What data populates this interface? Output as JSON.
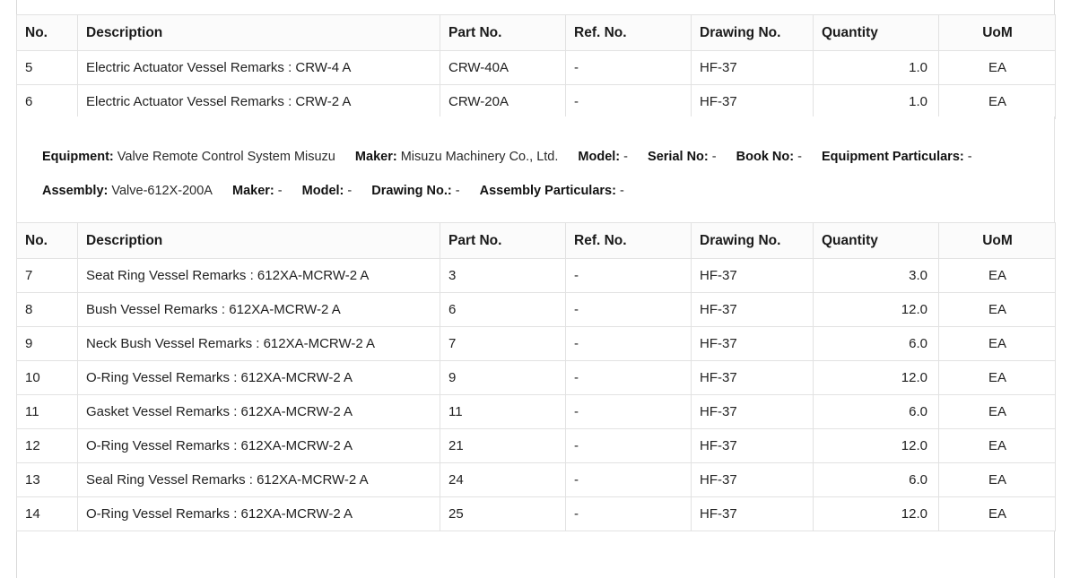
{
  "table_top": {
    "columns": [
      "No.",
      "Description",
      "Part No.",
      "Ref. No.",
      "Drawing No.",
      "Quantity",
      "UoM"
    ],
    "rows": [
      {
        "no": "5",
        "description": "Electric Actuator Vessel Remarks : CRW-4 A",
        "part_no": "CRW-40A",
        "ref_no": "-",
        "drawing_no": "HF-37",
        "quantity": "1.0",
        "uom": "EA"
      },
      {
        "no": "6",
        "description": "Electric Actuator Vessel Remarks : CRW-2 A",
        "part_no": "CRW-20A",
        "ref_no": "-",
        "drawing_no": "HF-37",
        "quantity": "1.0",
        "uom": "EA"
      }
    ]
  },
  "meta": {
    "line1": [
      {
        "key": "Equipment:",
        "value": "Valve Remote Control System Misuzu"
      },
      {
        "key": "Maker:",
        "value": "Misuzu Machinery Co., Ltd."
      },
      {
        "key": "Model:",
        "value": "-"
      },
      {
        "key": "Serial No:",
        "value": "-"
      },
      {
        "key": "Book No:",
        "value": "-"
      },
      {
        "key": "Equipment Particulars:",
        "value": "-"
      }
    ],
    "line2": [
      {
        "key": "Assembly:",
        "value": "Valve-612X-200A"
      },
      {
        "key": "Maker:",
        "value": "-"
      },
      {
        "key": "Model:",
        "value": "-"
      },
      {
        "key": "Drawing No.:",
        "value": "-"
      },
      {
        "key": "Assembly Particulars:",
        "value": "-"
      }
    ]
  },
  "table_bottom": {
    "columns": [
      "No.",
      "Description",
      "Part No.",
      "Ref. No.",
      "Drawing No.",
      "Quantity",
      "UoM"
    ],
    "rows": [
      {
        "no": "7",
        "description": "Seat Ring Vessel Remarks : 612XA-MCRW-2 A",
        "part_no": "3",
        "ref_no": "-",
        "drawing_no": "HF-37",
        "quantity": "3.0",
        "uom": "EA"
      },
      {
        "no": "8",
        "description": "Bush Vessel Remarks : 612XA-MCRW-2 A",
        "part_no": "6",
        "ref_no": "-",
        "drawing_no": "HF-37",
        "quantity": "12.0",
        "uom": "EA"
      },
      {
        "no": "9",
        "description": "Neck Bush Vessel Remarks : 612XA-MCRW-2 A",
        "part_no": "7",
        "ref_no": "-",
        "drawing_no": "HF-37",
        "quantity": "6.0",
        "uom": "EA"
      },
      {
        "no": "10",
        "description": "O-Ring Vessel Remarks : 612XA-MCRW-2 A",
        "part_no": "9",
        "ref_no": "-",
        "drawing_no": "HF-37",
        "quantity": "12.0",
        "uom": "EA"
      },
      {
        "no": "11",
        "description": "Gasket Vessel Remarks : 612XA-MCRW-2 A",
        "part_no": "11",
        "ref_no": "-",
        "drawing_no": "HF-37",
        "quantity": "6.0",
        "uom": "EA"
      },
      {
        "no": "12",
        "description": "O-Ring Vessel Remarks : 612XA-MCRW-2 A",
        "part_no": "21",
        "ref_no": "-",
        "drawing_no": "HF-37",
        "quantity": "12.0",
        "uom": "EA"
      },
      {
        "no": "13",
        "description": "Seal Ring Vessel Remarks : 612XA-MCRW-2 A",
        "part_no": "24",
        "ref_no": "-",
        "drawing_no": "HF-37",
        "quantity": "6.0",
        "uom": "EA"
      },
      {
        "no": "14",
        "description": "O-Ring Vessel Remarks : 612XA-MCRW-2 A",
        "part_no": "25",
        "ref_no": "-",
        "drawing_no": "HF-37",
        "quantity": "12.0",
        "uom": "EA"
      }
    ]
  },
  "colors": {
    "border": "#e2e2e2",
    "header_bg": "#fbfbfb",
    "text": "#222222"
  }
}
